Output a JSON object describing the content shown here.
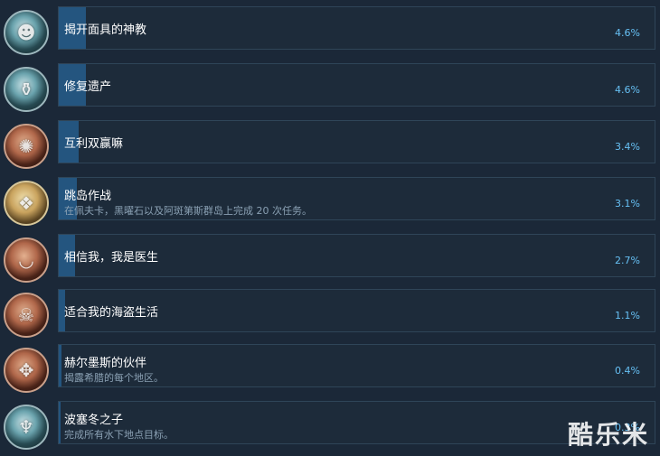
{
  "achievements": [
    {
      "title": "揭开面具的神教",
      "desc": "",
      "pct": "4.6%",
      "progress": 0.046,
      "icon": "masked-face-icon"
    },
    {
      "title": "修复遗产",
      "desc": "",
      "pct": "4.6%",
      "progress": 0.046,
      "icon": "relic-icon"
    },
    {
      "title": "互利双赢嘛",
      "desc": "",
      "pct": "3.4%",
      "progress": 0.034,
      "icon": "handshake-icon"
    },
    {
      "title": "跳岛作战",
      "desc": "在佩夫卡，黑曜石以及阿斑第斯群岛上完成 20 次任务。",
      "pct": "3.1%",
      "progress": 0.031,
      "icon": "knot-icon"
    },
    {
      "title": "相信我，我是医生",
      "desc": "",
      "pct": "2.7%",
      "progress": 0.027,
      "icon": "mortar-pestle-icon"
    },
    {
      "title": "适合我的海盗生活",
      "desc": "",
      "pct": "1.1%",
      "progress": 0.011,
      "icon": "pirate-icon"
    },
    {
      "title": "赫尔墨斯的伙伴",
      "desc": "揭露希腊的每个地区。",
      "pct": "0.4%",
      "progress": 0.004,
      "icon": "compass-icon"
    },
    {
      "title": "波塞冬之子",
      "desc": "完成所有水下地点目标。",
      "pct": "0.3%",
      "progress": 0.003,
      "icon": "trident-icon"
    }
  ],
  "watermark": "酷乐米"
}
